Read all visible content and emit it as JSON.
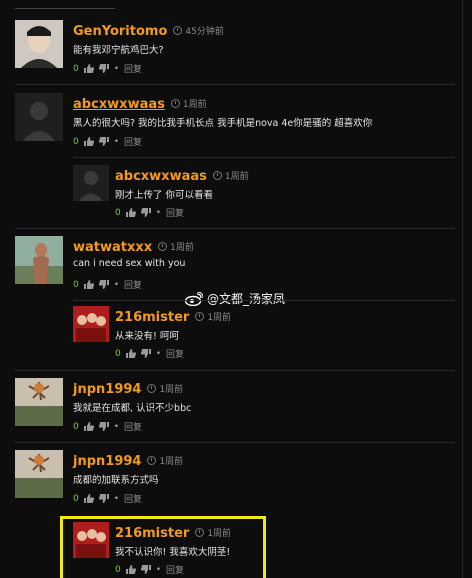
{
  "comments": [
    {
      "user": "GenYoritomo",
      "time": "45分钟前",
      "text": "能有我邓宁航鸡巴大?",
      "likes": "0",
      "reply": "回复"
    },
    {
      "user": "abcxwxwaas",
      "time": "1周前",
      "text": "黑人的很大吗? 我的比我手机长点 我手机是nova 4e你是骚的 超喜欢你",
      "likes": "0",
      "reply": "回复"
    },
    {
      "user": "abcxwxwaas",
      "time": "1周前",
      "text": "刚才上传了 你可以看看",
      "likes": "0",
      "reply": "回复"
    },
    {
      "user": "watwatxxx",
      "time": "1周前",
      "text": "can i need sex with you",
      "likes": "0",
      "reply": "回复"
    },
    {
      "user": "216mister",
      "time": "1周前",
      "text": "从来没有! 呵呵",
      "likes": "0",
      "reply": "回复"
    },
    {
      "user": "jnpn1994",
      "time": "1周前",
      "text": "我就是在成都, 认识不少bbc",
      "likes": "0",
      "reply": "回复"
    },
    {
      "user": "jnpn1994",
      "time": "1周前",
      "text": "成都的加联系方式吗",
      "likes": "0",
      "reply": "回复"
    },
    {
      "user": "216mister",
      "time": "1周前",
      "text": "我不认识你! 我喜欢大阴茎!",
      "likes": "0",
      "reply": "回复"
    }
  ],
  "watermark": {
    "text": "@文都_汤家凤"
  },
  "colors": {
    "username": "#f39a1e",
    "count": "#7ec83e",
    "highlight": "#f3ea12"
  },
  "icons": [
    "thumbs-up-icon",
    "thumbs-down-icon",
    "clock-icon",
    "weibo-icon"
  ]
}
